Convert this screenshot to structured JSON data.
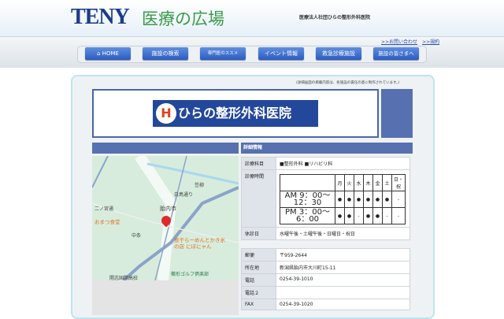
{
  "header": {
    "logo": "TENY",
    "logo_jp": "医療の広場",
    "org": "医療法人社団ひらの整形外科医院"
  },
  "toplinks": [
    ">>お問い合わせ",
    ">>規約"
  ],
  "nav": [
    "HOME",
    "施設の検索",
    "専門医のススメ",
    "イベント情報",
    "救急診療施設",
    "施設の皆さまへ"
  ],
  "note": "(詳細画面の掲載内容は、各施設の責任の基に制作されています。)",
  "clinic": {
    "name": "ひらの整形外科医院",
    "icon": "H"
  },
  "section_title": "詳細情報",
  "map": {
    "labels": [
      "胎内市",
      "白鳥通り",
      "笠柳",
      "二ノ宮通",
      "中条",
      "開志国際高校",
      "櫛形ゴルフ倶楽部"
    ],
    "places": [
      "おまつ食堂",
      "煮干らーめんとかき氷",
      "の店 にぼにゃん"
    ]
  },
  "details": {
    "dept_label": "診療科目",
    "dept": "■整形外科 ■リハビリ科",
    "hours_label": "診療時間",
    "days": [
      "月",
      "火",
      "水",
      "木",
      "金",
      "土",
      "日・祝"
    ],
    "am": {
      "time": "AM 9：00〜 12：30",
      "marks": [
        "●",
        "●",
        "●",
        "●",
        "●",
        "●",
        "-"
      ]
    },
    "pm": {
      "time": "PM 3：00〜 6：00",
      "marks": [
        "●",
        "●",
        "-",
        "●",
        "●",
        "-",
        "-"
      ]
    },
    "holiday_label": "休診日",
    "holiday": "水曜午後・土曜午後・日曜日・祝日"
  },
  "contact": [
    {
      "k": "郵便",
      "v": "〒959-2644"
    },
    {
      "k": "所在地",
      "v": "新潟県胎内市大川町15-11"
    },
    {
      "k": "電話",
      "v": "0254-39-1010"
    },
    {
      "k": "電話２",
      "v": ""
    },
    {
      "k": "FAX",
      "v": "0254-39-1020"
    }
  ]
}
